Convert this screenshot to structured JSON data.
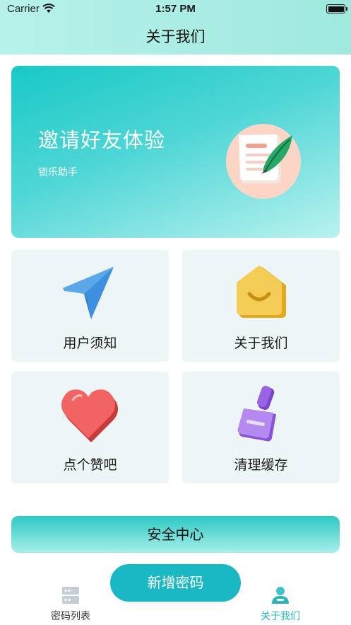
{
  "status_bar": {
    "carrier": "Carrier",
    "time": "1:57 PM"
  },
  "nav": {
    "title": "关于我们"
  },
  "banner": {
    "title": "邀请好友体验",
    "subtitle": "锁乐助手",
    "icon": "notepad-quill-icon"
  },
  "tiles": [
    {
      "label": "用户须知",
      "icon": "paper-plane-icon"
    },
    {
      "label": "关于我们",
      "icon": "smile-house-icon"
    },
    {
      "label": "点个赞吧",
      "icon": "heart-icon"
    },
    {
      "label": "清理缓存",
      "icon": "broom-brush-icon"
    }
  ],
  "security_button": {
    "label": "安全中心"
  },
  "add_button": {
    "label": "新增密码"
  },
  "tab_bar": {
    "items": [
      {
        "label": "密码列表",
        "icon": "server-list-icon",
        "active": false
      },
      {
        "label": "关于我们",
        "icon": "user-profile-icon",
        "active": true
      }
    ]
  },
  "colors": {
    "accent": "#1ab8c4",
    "header_bg": "#a8ece3",
    "tile_bg": "#eef5f6",
    "active_tab": "#1fb8c2"
  }
}
